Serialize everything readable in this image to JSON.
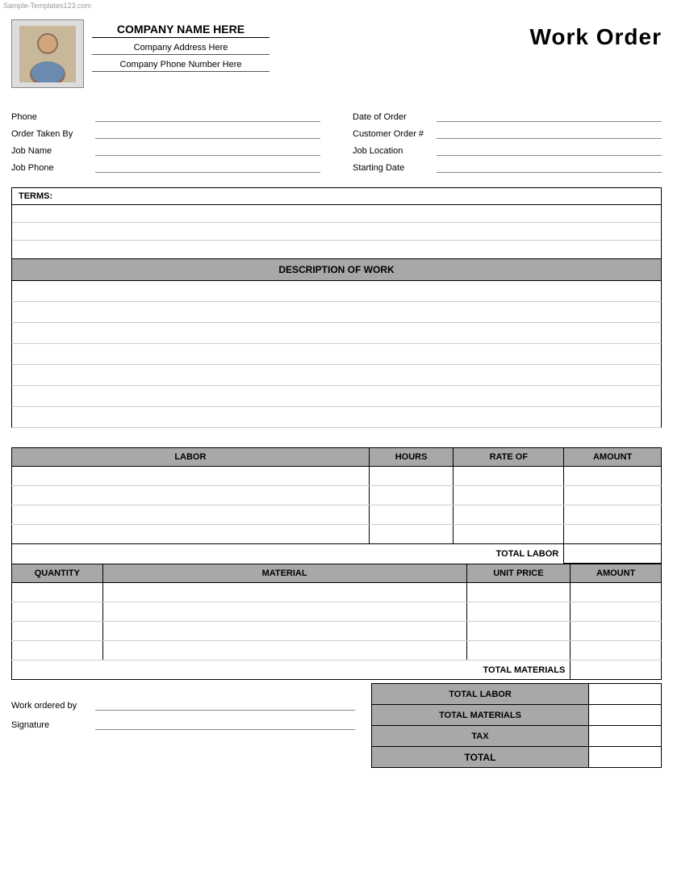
{
  "watermark": "Sample-Templates123.com",
  "header": {
    "company_name": "COMPANY NAME HERE",
    "company_address": "Company Address Here",
    "company_phone": "Company Phone Number Here",
    "title": "Work Order"
  },
  "fields": {
    "left": [
      {
        "label": "Phone",
        "value": ""
      },
      {
        "label": "Order Taken By",
        "value": ""
      },
      {
        "label": "Job Name",
        "value": ""
      },
      {
        "label": "Job Phone",
        "value": ""
      }
    ],
    "right": [
      {
        "label": "Date of Order",
        "value": ""
      },
      {
        "label": "Customer Order #",
        "value": ""
      },
      {
        "label": "Job Location",
        "value": ""
      },
      {
        "label": "Starting Date",
        "value": ""
      }
    ]
  },
  "terms": {
    "label": "TERMS:",
    "rows": 3
  },
  "description": {
    "header": "DESCRIPTION OF WORK",
    "rows": 7
  },
  "labor": {
    "columns": [
      "LABOR",
      "HOURS",
      "RATE OF",
      "AMOUNT"
    ],
    "rows": 4,
    "total_label": "TOTAL LABOR"
  },
  "materials": {
    "columns": [
      "QUANTITY",
      "MATERIAL",
      "UNIT PRICE",
      "AMOUNT"
    ],
    "rows": 4,
    "total_label": "TOTAL MATERIALS"
  },
  "summary": {
    "rows": [
      {
        "label": "TOTAL LABOR",
        "value": ""
      },
      {
        "label": "TOTAL MATERIALS",
        "value": ""
      },
      {
        "label": "TAX",
        "value": ""
      },
      {
        "label": "TOTAL",
        "value": ""
      }
    ]
  },
  "footer": {
    "work_ordered_by_label": "Work ordered by",
    "signature_label": "Signature"
  }
}
